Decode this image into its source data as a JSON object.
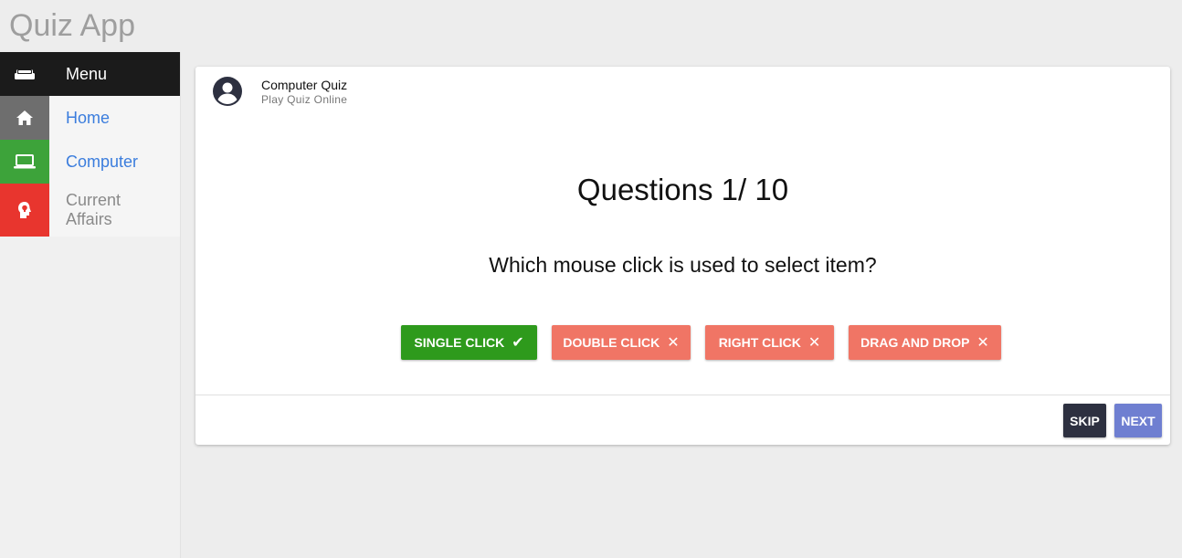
{
  "app": {
    "title": "Quiz App"
  },
  "sidebar": {
    "items": [
      {
        "label": "Menu",
        "icon": "couch-icon",
        "color": "#1b1b1b"
      },
      {
        "label": "Home",
        "icon": "home-icon",
        "color": "#6e6e6e"
      },
      {
        "label": "Computer",
        "icon": "laptop-icon",
        "color": "#3da33a"
      },
      {
        "label": "Current Affairs",
        "icon": "head-bulb-icon",
        "color": "#e8352e"
      }
    ]
  },
  "card": {
    "title": "Computer Quiz",
    "subtitle": "Play Quiz Online",
    "question_count": "Questions 1/ 10",
    "question": "Which mouse click is used to select item?",
    "options": [
      {
        "label": "SINGLE CLICK",
        "status": "correct",
        "mark": "✔"
      },
      {
        "label": "DOUBLE CLICK",
        "status": "wrong",
        "mark": "✕"
      },
      {
        "label": "RIGHT CLICK",
        "status": "wrong",
        "mark": "✕"
      },
      {
        "label": "DRAG AND DROP",
        "status": "wrong",
        "mark": "✕"
      }
    ],
    "skip_label": "SKIP",
    "next_label": "NEXT"
  },
  "colors": {
    "correct": "#2e9a1c",
    "wrong": "#f07565",
    "skip": "#2d3040",
    "next": "#6f7fd1",
    "link": "#3b7ddd"
  }
}
